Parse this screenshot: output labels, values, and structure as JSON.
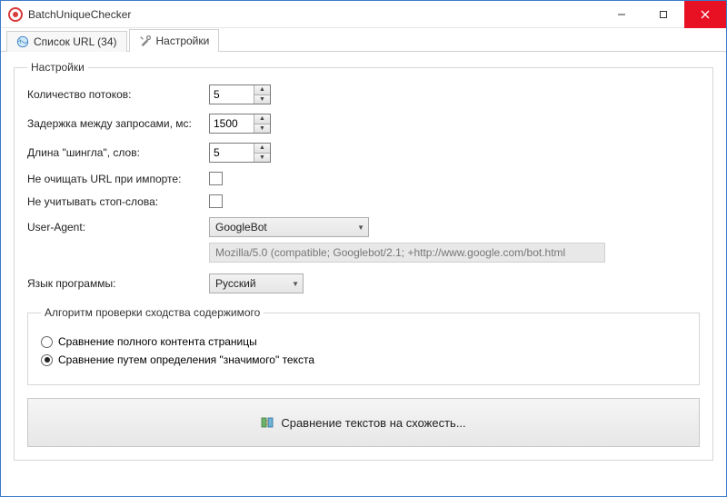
{
  "window": {
    "title": "BatchUniqueChecker"
  },
  "tabs": {
    "list": {
      "label": "Список URL (34)"
    },
    "settings": {
      "label": "Настройки"
    }
  },
  "settings": {
    "legend": "Настройки",
    "threads_label": "Количество потоков:",
    "threads_value": "5",
    "delay_label": "Задержка между запросами, мс:",
    "delay_value": "1500",
    "shingle_label": "Длина \"шингла\", слов:",
    "shingle_value": "5",
    "noclear_label": "Не очищать URL при импорте:",
    "nostop_label": "Не учитывать стоп-слова:",
    "ua_label": "User-Agent:",
    "ua_selected": "GoogleBot",
    "ua_string": "Mozilla/5.0 (compatible; Googlebot/2.1; +http://www.google.com/bot.html",
    "lang_label": "Язык программы:",
    "lang_selected": "Русский"
  },
  "algo": {
    "legend": "Алгоритм проверки сходства содержимого",
    "opt_full": "Сравнение полного контента страницы",
    "opt_meaning": "Сравнение путем определения \"значимого\" текста"
  },
  "compare_button": "Сравнение текстов на схожесть..."
}
